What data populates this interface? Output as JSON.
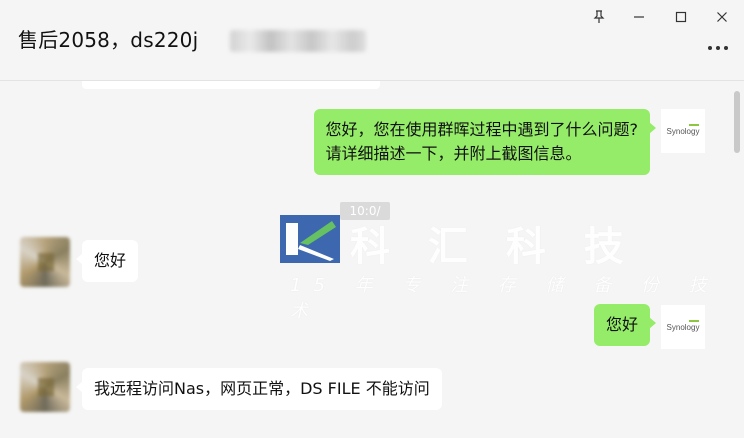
{
  "window": {
    "title": "售后2058，ds220j",
    "controls": {
      "pin_icon": "pin-icon",
      "minimize_icon": "minimize-icon",
      "maximize_icon": "maximize-icon",
      "close_icon": "close-icon"
    },
    "more_icon": "more-dots-icon"
  },
  "chat": {
    "timestamp": "10:0/",
    "messages": [
      {
        "side": "out",
        "lines": [
          "您好，您在使用群晖过程中遇到了什么问题?",
          "请详细描述一下，并附上截图信息。"
        ],
        "avatar": "Synology"
      },
      {
        "side": "in",
        "lines": [
          "您好"
        ]
      },
      {
        "side": "out",
        "lines": [
          "您好"
        ],
        "avatar": "Synology"
      },
      {
        "side": "in",
        "lines": [
          "我远程访问Nas，网页正常，DS FILE 不能访问"
        ]
      }
    ]
  },
  "watermark": {
    "text": "科 汇 科 技",
    "subtitle": "15 年 专 注 存 储 备 份 技 术",
    "colors": {
      "blue": "#1e4fa3",
      "green": "#4cb848"
    }
  },
  "colors": {
    "bubble_out": "#95ec69",
    "bubble_in": "#ffffff",
    "background": "#f5f5f5"
  }
}
